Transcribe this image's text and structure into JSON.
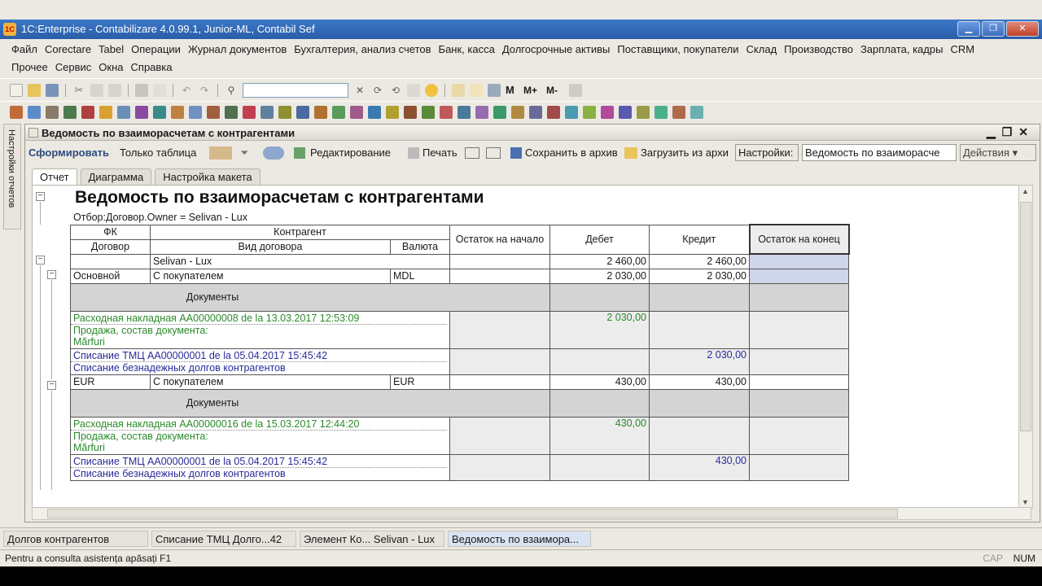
{
  "window": {
    "title": "1C:Enterprise - Contabilizare 4.0.99.1, Junior-ML, Contabil Sef",
    "app_icon": "1C"
  },
  "menu": {
    "row1": [
      "Файл",
      "Corectare",
      "Tabel",
      "Операции",
      "Журнал документов",
      "Бухгалтерия, анализ счетов",
      "Банк, касса",
      "Долгосрочные активы",
      "Поставщики, покупатели",
      "Склад",
      "Производство",
      "Зарплата, кадры",
      "CRM"
    ],
    "row2": [
      "Прочее",
      "Сервис",
      "Окна",
      "Справка"
    ]
  },
  "side_panel_label": "Настройки отчетов",
  "doc": {
    "title": "Ведомость по взаиморасчетам с контрагентами",
    "toolbar": {
      "generate": "Сформировать",
      "only_table": "Только таблица",
      "editing": "Редактирование",
      "print": "Печать",
      "save_archive": "Сохранить в архив",
      "load_archive": "Загрузить из архи",
      "settings_label": "Настройки:",
      "settings_value": "Ведомость по взаиморасче",
      "actions": "Действия"
    },
    "tabs": [
      "Отчет",
      "Диаграмма",
      "Настройка макета"
    ]
  },
  "report": {
    "title": "Ведомость по взаиморасчетам с контрагентами",
    "filter": "Отбор:Договор.Owner = Selivan - Lux",
    "headers": {
      "fk": "ФК",
      "counterparty": "Контрагент",
      "contract": "Договор",
      "contract_type": "Вид договора",
      "currency": "Валюта",
      "start_balance": "Остаток на начало",
      "debit": "Дебет",
      "credit": "Кредит",
      "end_balance": "Остаток на конец"
    },
    "summary": {
      "name": "Selivan - Lux",
      "debit": "2 460,00",
      "credit": "2 460,00"
    },
    "groups": [
      {
        "contract": "Основной",
        "type": "С покупателем",
        "currency": "MDL",
        "debit": "2 030,00",
        "credit": "2 030,00",
        "docs_label": "Документы",
        "docs": [
          {
            "line1": "Расходная накладная АА00000008 de la 13.03.2017 12:53:09",
            "line2": "Продажа, состав документа:",
            "line3": "Mărfuri",
            "debit": "2 030,00",
            "credit": ""
          },
          {
            "line1": "Списание ТМЦ АА00000001 de la 05.04.2017 15:45:42",
            "line2": "Списание безнадежных долгов контрагентов",
            "line3": "",
            "debit": "",
            "credit": "2 030,00"
          }
        ]
      },
      {
        "contract": "EUR",
        "type": "С покупателем",
        "currency": "EUR",
        "debit": "430,00",
        "credit": "430,00",
        "docs_label": "Документы",
        "docs": [
          {
            "line1": "Расходная накладная АА00000016 de la 15.03.2017 12:44:20",
            "line2": "Продажа, состав документа:",
            "line3": "Mărfuri",
            "debit": "430,00",
            "credit": ""
          },
          {
            "line1": "Списание ТМЦ АА00000001 de la 05.04.2017 15:45:42",
            "line2": "Списание безнадежных долгов контрагентов",
            "line3": "",
            "debit": "",
            "credit": "430,00"
          }
        ]
      }
    ]
  },
  "taskbar": [
    {
      "label": "Долгов контрагентов",
      "active": false
    },
    {
      "label": "Списание ТМЦ Долго...42",
      "active": false
    },
    {
      "label": "Элемент Ко... Selivan - Lux",
      "active": false
    },
    {
      "label": "Ведомость по взаимора...",
      "active": true
    }
  ],
  "status": {
    "message": "Pentru a consulta asistența apăsați F1",
    "cap": "CAP",
    "num": "NUM"
  }
}
